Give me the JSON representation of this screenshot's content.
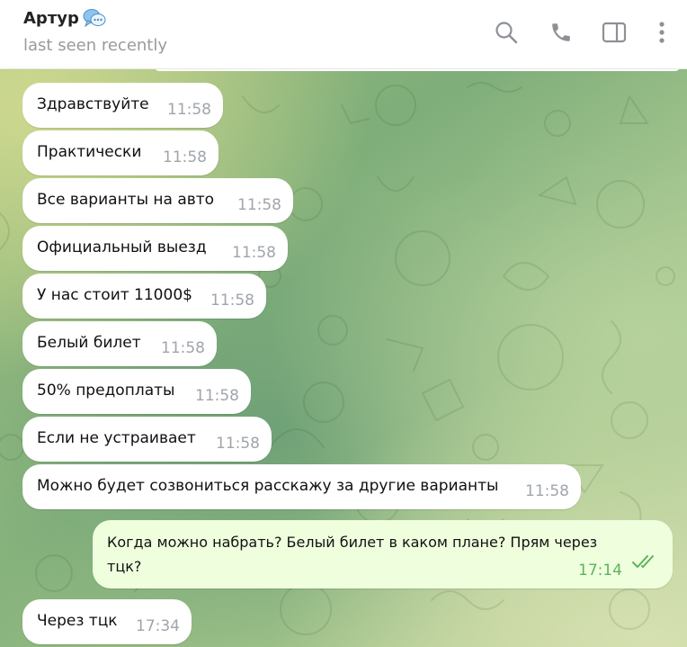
{
  "header": {
    "contact_name": "Артур",
    "status": "last seen recently",
    "icons": [
      "search-icon",
      "phone-icon",
      "sidebar-toggle-icon",
      "more-vertical-icon"
    ]
  },
  "colors": {
    "incoming_bubble": "#ffffff",
    "outgoing_bubble": "#effedd",
    "outgoing_time": "#5eb35e",
    "incoming_time": "#a0a5ab"
  },
  "messages": [
    {
      "direction": "in",
      "text": "Здравствуйте",
      "time": "11:58"
    },
    {
      "direction": "in",
      "text": "Практически",
      "time": "11:58"
    },
    {
      "direction": "in",
      "text": "Все варианты на авто",
      "time": "11:58"
    },
    {
      "direction": "in",
      "text": "Официальный выезд",
      "time": "11:58"
    },
    {
      "direction": "in",
      "text": "У нас стоит 11000$",
      "time": "11:58"
    },
    {
      "direction": "in",
      "text": "Белый билет",
      "time": "11:58"
    },
    {
      "direction": "in",
      "text": "50% предоплаты",
      "time": "11:58"
    },
    {
      "direction": "in",
      "text": "Если не устраивает",
      "time": "11:58"
    },
    {
      "direction": "in",
      "text": "Можно будет созвониться расскажу за другие варианты",
      "time": "11:58"
    },
    {
      "direction": "out",
      "text_line1": "Когда можно набрать? Белый билет в каком плане? Прям через",
      "text_line2": "тцк?",
      "time": "17:14",
      "read": true
    },
    {
      "direction": "in",
      "text": "Через тцк",
      "time": "17:34"
    }
  ]
}
